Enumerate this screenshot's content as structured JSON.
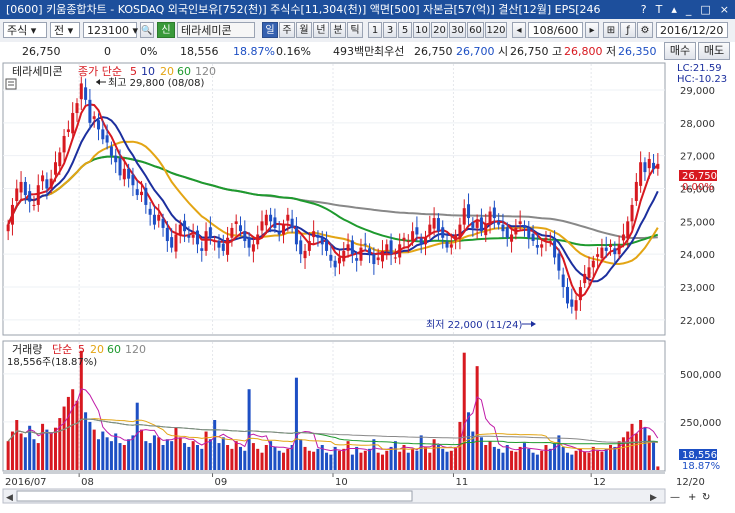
{
  "title": "[0600] 키움종합차트 - KOSDAQ 외국인보유[752(천)] 주식수[11,304(천)] 액면[500] 자본금[57(억)] 결산[12월] EPS[246",
  "title_icons": [
    "help-icon",
    "text-size-icon",
    "pin-icon",
    "minimize-icon",
    "maximize-icon",
    "close-icon"
  ],
  "toolbar": {
    "market_type": "주식",
    "period_option": "전",
    "stock_code": "123100",
    "credit_badge": "신",
    "stock_name": "테라세미콘",
    "period_tabs": [
      "일",
      "주",
      "월",
      "년",
      "분",
      "틱"
    ],
    "active_period": "일",
    "intervals": [
      "1",
      "3",
      "5",
      "10",
      "20",
      "30",
      "60",
      "120"
    ],
    "page_counter": "108/600",
    "date": "2016/12/20"
  },
  "quote": {
    "price": "26,750",
    "change": "0",
    "change_rate": "0%",
    "volume": "18,556",
    "volume_ratio": "18.87%",
    "turnover": "0.16%",
    "trading_value": "493백만",
    "best_bid_label": "최우선",
    "best_bid": "26,750",
    "best_ask": "26,700",
    "open_label": "시",
    "open": "26,750",
    "high_label": "고",
    "high": "26,800",
    "low_label": "저",
    "low": "26,350",
    "buy_label": "매수",
    "sell_label": "매도"
  },
  "price_panel": {
    "legend_name": "테라세미콘",
    "legend_series_label": "종가 단순",
    "ma_periods": [
      "5",
      "10",
      "20",
      "60",
      "120"
    ],
    "ma_colors": [
      "#d71920",
      "#1c2f9e",
      "#e3a514",
      "#1e9a2e",
      "#888888"
    ],
    "lc_label": "LC:21.59",
    "hc_label": "HC:-10.23",
    "last_price_tag": "26,750",
    "last_rate_tag": "0.00%",
    "high_annotation": "최고 29,800 (08/08)",
    "low_annotation": "최저 22,000 (11/24)"
  },
  "volume_panel": {
    "legend_name": "거래량",
    "legend_series_label": "단순",
    "ma_periods": [
      "5",
      "20",
      "60",
      "120"
    ],
    "current_label": "18,556주(18.87%)",
    "last_volume_tag": "18,556",
    "last_rate_tag": "18.87%"
  },
  "x_axis": {
    "labels": [
      "2016/07",
      "08",
      "09",
      "10",
      "11",
      "12",
      "12/20"
    ]
  },
  "chart_data": {
    "type": "candlestick",
    "ylim": [
      21600,
      29700
    ],
    "y_ticks": [
      22000,
      23000,
      24000,
      25000,
      26000,
      27000,
      28000,
      29000
    ],
    "volume_ylim": [
      0,
      650000
    ],
    "volume_ticks": [
      250000,
      500000
    ],
    "month_starts": [
      {
        "label": "08",
        "index": 17
      },
      {
        "label": "09",
        "index": 48
      },
      {
        "label": "10",
        "index": 76
      },
      {
        "label": "11",
        "index": 104
      },
      {
        "label": "12",
        "index": 136
      }
    ],
    "closes": [
      24900,
      25500,
      26000,
      26200,
      25800,
      25600,
      25500,
      26100,
      26400,
      26000,
      26300,
      26800,
      27100,
      27600,
      27800,
      28300,
      28600,
      29200,
      28700,
      28000,
      28200,
      27800,
      27500,
      27400,
      27000,
      26800,
      26400,
      26600,
      26300,
      26100,
      25800,
      25900,
      25500,
      25200,
      24900,
      25200,
      24800,
      24400,
      24200,
      24600,
      24900,
      24700,
      24500,
      24600,
      24300,
      24100,
      24700,
      24500,
      24400,
      24200,
      24100,
      24500,
      24800,
      25000,
      24700,
      24400,
      24200,
      24300,
      24600,
      25000,
      25200,
      25000,
      24800,
      24600,
      24900,
      25200,
      24800,
      24300,
      24000,
      24100,
      24400,
      24700,
      24500,
      24300,
      24100,
      23800,
      23600,
      23900,
      24100,
      24300,
      24000,
      23800,
      24200,
      24300,
      24000,
      23700,
      23900,
      24100,
      24300,
      24000,
      23900,
      24300,
      24500,
      24400,
      24700,
      24600,
      24300,
      24500,
      24900,
      25100,
      24700,
      24500,
      24200,
      24300,
      24600,
      24900,
      25400,
      25100,
      24800,
      25000,
      24700,
      24900,
      25300,
      25100,
      24900,
      24700,
      24500,
      24600,
      24800,
      25000,
      24800,
      24500,
      24400,
      24200,
      24300,
      24500,
      24400,
      23900,
      23500,
      23000,
      22500,
      22400,
      22600,
      23000,
      23400,
      23600,
      23800,
      24000,
      24200,
      24100,
      24300,
      24000,
      24300,
      24600,
      25000,
      25500,
      26200,
      26800,
      26500,
      26900,
      26600,
      26750
    ],
    "volumes": [
      150000,
      200000,
      260000,
      190000,
      170000,
      230000,
      160000,
      140000,
      240000,
      210000,
      190000,
      220000,
      270000,
      330000,
      380000,
      420000,
      360000,
      620000,
      300000,
      250000,
      210000,
      160000,
      200000,
      170000,
      150000,
      190000,
      140000,
      130000,
      160000,
      180000,
      350000,
      210000,
      150000,
      140000,
      180000,
      170000,
      130000,
      160000,
      150000,
      220000,
      170000,
      140000,
      120000,
      150000,
      130000,
      110000,
      200000,
      160000,
      260000,
      140000,
      170000,
      130000,
      110000,
      150000,
      120000,
      100000,
      420000,
      140000,
      110000,
      90000,
      130000,
      150000,
      120000,
      100000,
      90000,
      110000,
      130000,
      480000,
      160000,
      120000,
      100000,
      95000,
      110000,
      130000,
      90000,
      80000,
      120000,
      100000,
      110000,
      150000,
      80000,
      120000,
      90000,
      100000,
      110000,
      160000,
      90000,
      80000,
      100000,
      120000,
      150000,
      95000,
      130000,
      90000,
      110000,
      100000,
      180000,
      120000,
      90000,
      160000,
      130000,
      110000,
      95000,
      100000,
      120000,
      250000,
      610000,
      300000,
      200000,
      540000,
      170000,
      130000,
      150000,
      120000,
      110000,
      90000,
      130000,
      100000,
      95000,
      120000,
      140000,
      110000,
      90000,
      80000,
      100000,
      130000,
      110000,
      140000,
      180000,
      120000,
      90000,
      80000,
      100000,
      110000,
      95000,
      90000,
      120000,
      100000,
      95000,
      110000,
      130000,
      120000,
      150000,
      170000,
      200000,
      240000,
      190000,
      260000,
      220000,
      180000,
      150000,
      18556
    ]
  }
}
